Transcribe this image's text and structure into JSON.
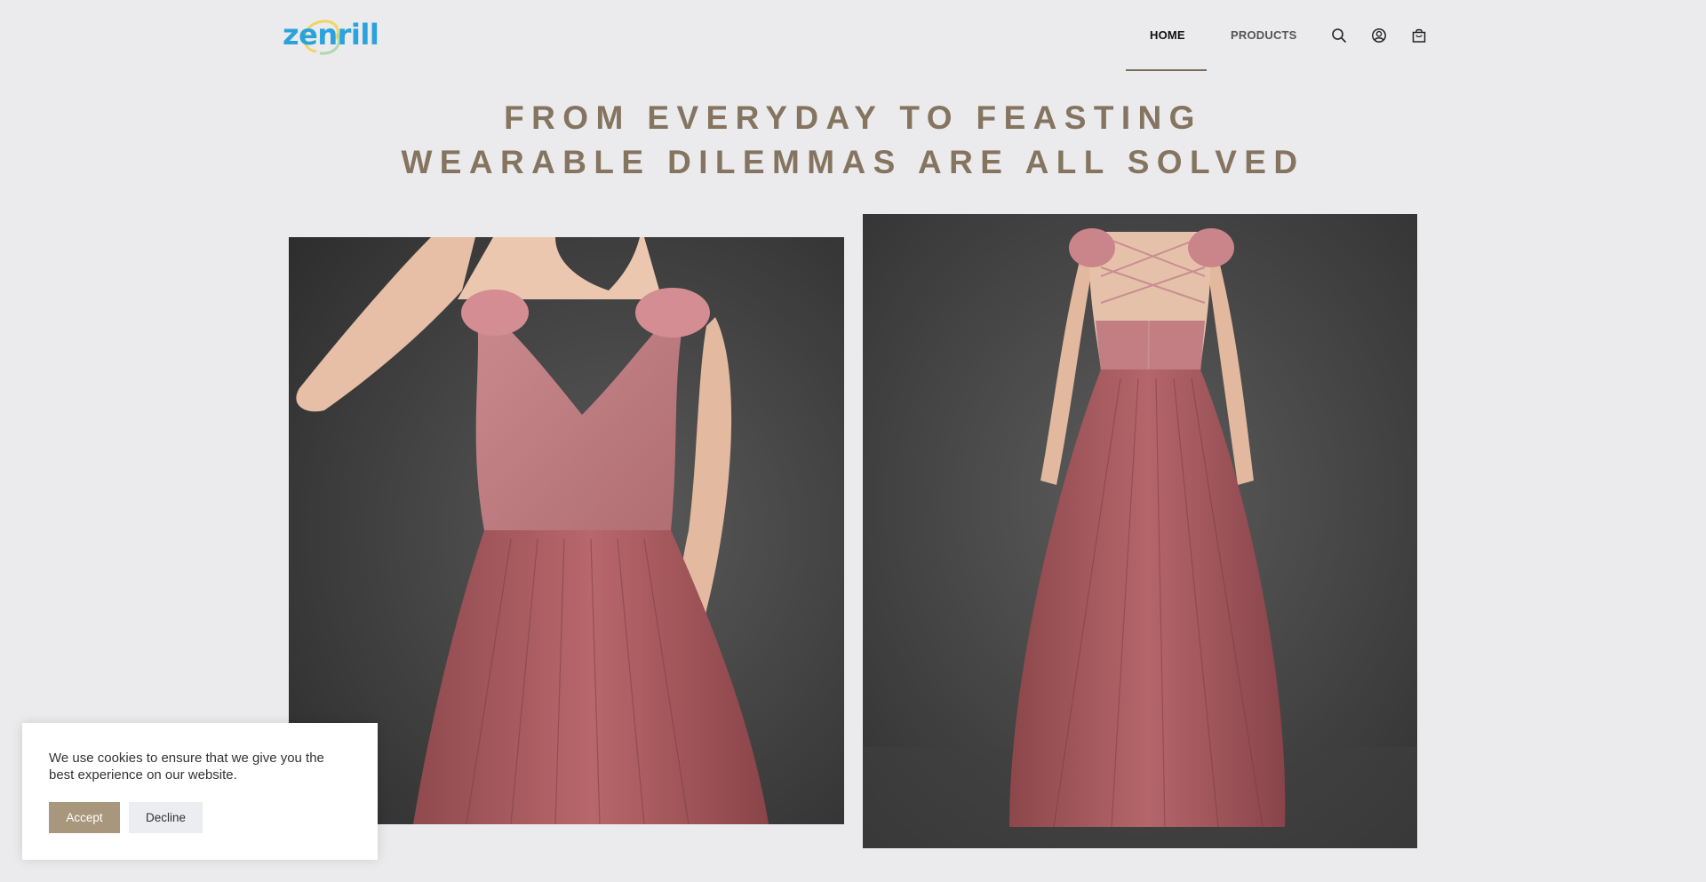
{
  "brand": {
    "logo_text": "zenrill",
    "logo_color": "#2aa3dc"
  },
  "nav": {
    "items": [
      {
        "label": "HOME",
        "active": true
      },
      {
        "label": "PRODUCTS",
        "active": false
      }
    ],
    "icons": [
      "search-icon",
      "account-icon",
      "cart-icon"
    ]
  },
  "hero": {
    "line1": "FROM EVERYDAY TO FEASTING",
    "line2": "WEARABLE DILEMMAS ARE ALL SOLVED",
    "color": "#857560"
  },
  "cookie": {
    "message": "We use cookies to ensure that we give you the best experience on our website.",
    "accept_label": "Accept",
    "decline_label": "Decline",
    "accept_color": "#a8967d"
  }
}
